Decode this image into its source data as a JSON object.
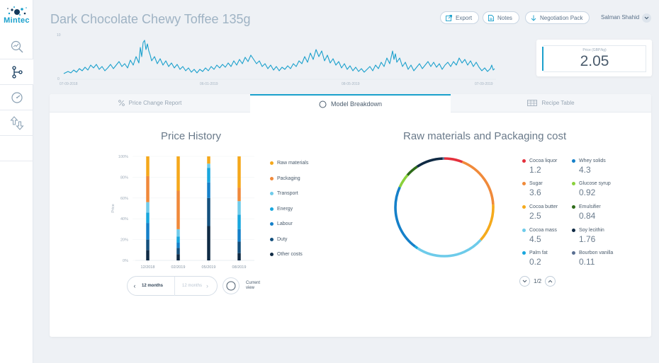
{
  "app": {
    "logo_text": "Mintec"
  },
  "sidebar": {
    "items": [
      {
        "icon": "magnify-chart-icon"
      },
      {
        "icon": "hierarchy-icon",
        "active": true
      },
      {
        "icon": "gauge-icon"
      },
      {
        "icon": "up-down-arrows-icon"
      }
    ]
  },
  "header": {
    "title": "Dark Chocolate Chewy Toffee 135g",
    "export_label": "Export",
    "notes_label": "Notes",
    "negotiation_label": "Negotiation Pack",
    "user_name": "Salman Shahid"
  },
  "sparkline": {
    "y_ticks": [
      "10",
      "0"
    ],
    "x_ticks": [
      "07-09-2018",
      "06-01-2019",
      "08-05-2019",
      "07-09-2019"
    ],
    "accent": "#1aa0cc"
  },
  "price": {
    "label": "Price (GBP/kg)",
    "value": "2.05"
  },
  "tabs": [
    {
      "label": "Price Change Report",
      "icon": "percent-icon"
    },
    {
      "label": "Model Breakdown",
      "icon": "circle-icon",
      "active": true
    },
    {
      "label": "Recipe Table",
      "icon": "table-icon"
    }
  ],
  "price_history": {
    "title": "Price History",
    "legend": [
      {
        "label": "Raw materials",
        "color": "#f5a81b"
      },
      {
        "label": "Packaging",
        "color": "#f0893a"
      },
      {
        "label": "Transport",
        "color": "#6fcbea"
      },
      {
        "label": "Energy",
        "color": "#18a7de"
      },
      {
        "label": "Labour",
        "color": "#1580c9"
      },
      {
        "label": "Duty",
        "color": "#14507d"
      },
      {
        "label": "Other costs",
        "color": "#0f2a44"
      }
    ],
    "period": {
      "current": "12 months",
      "next": "12 months"
    },
    "view_label": "Current view"
  },
  "chart_data": [
    {
      "type": "bar",
      "title": "Price History",
      "ylabel": "Price",
      "categories": [
        "12/2018",
        "02/2019",
        "05/2019",
        "08/2019"
      ],
      "y_ticks": [
        "0%",
        "20%",
        "40%",
        "60%",
        "80%",
        "100%"
      ],
      "ylim": [
        0,
        100
      ],
      "stacked": true,
      "series": [
        {
          "name": "Other costs",
          "color": "#0f2a44",
          "values": [
            10,
            6,
            33,
            7
          ]
        },
        {
          "name": "Duty",
          "color": "#14507d",
          "values": [
            10,
            6,
            27,
            11
          ]
        },
        {
          "name": "Labour",
          "color": "#1580c9",
          "values": [
            16,
            5,
            15,
            12
          ]
        },
        {
          "name": "Energy",
          "color": "#18a7de",
          "values": [
            10,
            6,
            14,
            14
          ]
        },
        {
          "name": "Transport",
          "color": "#6fcbea",
          "values": [
            10,
            7,
            4,
            13
          ]
        },
        {
          "name": "Packaging",
          "color": "#f0893a",
          "values": [
            25,
            37,
            0,
            13
          ]
        },
        {
          "name": "Raw materials",
          "color": "#f5a81b",
          "values": [
            19,
            33,
            7,
            30
          ]
        }
      ]
    },
    {
      "type": "pie",
      "title": "Raw materials and Packaging cost",
      "donut": true,
      "series": [
        {
          "name": "Cocoa liquor",
          "color": "#e4303c",
          "value": 1.2
        },
        {
          "name": "Sugar",
          "color": "#f08a3a",
          "value": 3.6
        },
        {
          "name": "Cocoa butter",
          "color": "#f5aa1c",
          "value": 2.5
        },
        {
          "name": "Cocoa mass",
          "color": "#6dcbea",
          "value": 4.5
        },
        {
          "name": "Palm fat",
          "color": "#18a7de",
          "value": 0.2
        },
        {
          "name": "Whey solids",
          "color": "#1580c9",
          "value": 4.3
        },
        {
          "name": "Glucose syrup",
          "color": "#8ad13c",
          "value": 0.92
        },
        {
          "name": "Emulsifier",
          "color": "#2e6b19",
          "value": 0.84
        },
        {
          "name": "Soy lecithin",
          "color": "#0f2a44",
          "value": 1.76
        },
        {
          "name": "Bourbon vanilla",
          "color": "#5a6f92",
          "value": 0.11
        }
      ]
    }
  ],
  "materials": {
    "title": "Raw materials and Packaging cost",
    "items": [
      {
        "label": "Cocoa liquor",
        "value": "1.2",
        "color": "#e4303c"
      },
      {
        "label": "Whey solids",
        "value": "4.3",
        "color": "#1580c9"
      },
      {
        "label": "Sugar",
        "value": "3.6",
        "color": "#f08a3a"
      },
      {
        "label": "Glucose syrup",
        "value": "0.92",
        "color": "#8ad13c"
      },
      {
        "label": "Cocoa butter",
        "value": "2.5",
        "color": "#f5aa1c"
      },
      {
        "label": "Emulsifier",
        "value": "0.84",
        "color": "#2e6b19"
      },
      {
        "label": "Cocoa mass",
        "value": "4.5",
        "color": "#6dcbea"
      },
      {
        "label": "Soy lecithin",
        "value": "1.76",
        "color": "#0f2a44"
      },
      {
        "label": "Palm fat",
        "value": "0.2",
        "color": "#18a7de"
      },
      {
        "label": "Bourbon vanilla",
        "value": "0.11",
        "color": "#5a6f92"
      }
    ],
    "page": "1/2"
  }
}
